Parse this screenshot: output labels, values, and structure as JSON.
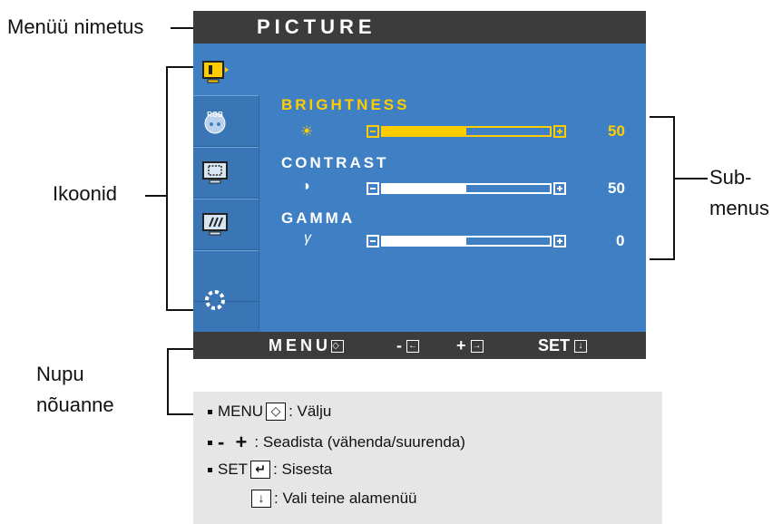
{
  "callouts": {
    "menu_name": "Menüü nimetus",
    "icons": "Ikoonid",
    "submenus_line1": "Sub-",
    "submenus_line2": "menus",
    "tips_line1": "Nupu",
    "tips_line2": "nõuanne"
  },
  "osd": {
    "title": "PICTURE",
    "sidebar_icons": [
      "picture-icon",
      "rgb-color-icon",
      "display-position-icon",
      "track-icon",
      "setup-icon"
    ],
    "active_icon_index": 0,
    "items": [
      {
        "label": "BRIGHTNESS",
        "symbol": "☀",
        "value": "50",
        "level": 0.5,
        "active": true
      },
      {
        "label": "CONTRAST",
        "symbol": "◑",
        "value": "50",
        "level": 0.5,
        "active": false
      },
      {
        "label": "GAMMA",
        "symbol": "γ",
        "value": "0",
        "level": 0.5,
        "active": false
      }
    ],
    "footer": {
      "menu": "MENU",
      "minus": "-",
      "plus": "+",
      "set": "SET"
    }
  },
  "hint": {
    "row1_key": "MENU",
    "row1_text": ": Välju",
    "row2_keys": "-  +",
    "row2_text": ": Seadista (vähenda/suurenda)",
    "row3_key": "SET",
    "row3_text": ": Sisesta",
    "row4_text": ": Vali teine alamenüü"
  },
  "colors": {
    "osd_blue": "#3f80c4",
    "osd_dark": "#3c3c3c",
    "active_yellow": "#ffcc00",
    "hint_bg": "#e6e6e6"
  }
}
